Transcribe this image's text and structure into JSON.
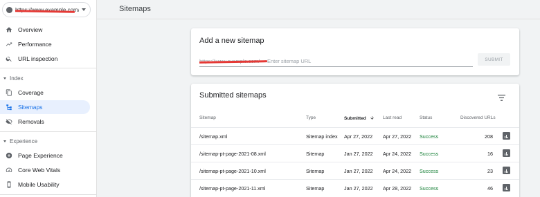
{
  "app": {
    "property_url": "https://www.example.com/",
    "page_title": "Sitemaps"
  },
  "sidebar": {
    "items_top": [
      {
        "label": "Overview",
        "icon": "home-icon"
      },
      {
        "label": "Performance",
        "icon": "trending-up-icon"
      },
      {
        "label": "URL inspection",
        "icon": "search-icon"
      }
    ],
    "sections": [
      {
        "header": "Index",
        "items": [
          {
            "label": "Coverage",
            "icon": "file-copy-icon"
          },
          {
            "label": "Sitemaps",
            "icon": "sitemap-icon",
            "active": true
          },
          {
            "label": "Removals",
            "icon": "visibility-off-icon"
          }
        ]
      },
      {
        "header": "Experience",
        "items": [
          {
            "label": "Page Experience",
            "icon": "add-circle-icon"
          },
          {
            "label": "Core Web Vitals",
            "icon": "speed-gauge-icon"
          },
          {
            "label": "Mobile Usability",
            "icon": "phone-icon"
          }
        ]
      }
    ]
  },
  "add_sitemap": {
    "title": "Add a new sitemap",
    "url_prefix": "https://www.example.com/",
    "placeholder": "Enter sitemap URL",
    "value": "",
    "submit_label": "SUBMIT"
  },
  "submitted": {
    "title": "Submitted sitemaps",
    "columns": [
      "Sitemap",
      "Type",
      "Submitted",
      "Last read",
      "Status",
      "Discovered URLs"
    ],
    "sorted_column": "Submitted",
    "rows": [
      {
        "sitemap": "/sitemap.xml",
        "type": "Sitemap index",
        "submitted": "Apr 27, 2022",
        "last_read": "Apr 27, 2022",
        "status": "Success",
        "discovered": "208"
      },
      {
        "sitemap": "/sitemap-pt-page-2021-08.xml",
        "type": "Sitemap",
        "submitted": "Jan 27, 2022",
        "last_read": "Apr 24, 2022",
        "status": "Success",
        "discovered": "16"
      },
      {
        "sitemap": "/sitemap-pt-page-2021-10.xml",
        "type": "Sitemap",
        "submitted": "Jan 27, 2022",
        "last_read": "Apr 24, 2022",
        "status": "Success",
        "discovered": "23"
      },
      {
        "sitemap": "/sitemap-pt-page-2021-11.xml",
        "type": "Sitemap",
        "submitted": "Jan 27, 2022",
        "last_read": "Apr 28, 2022",
        "status": "Success",
        "discovered": "46"
      }
    ]
  },
  "colors": {
    "accent": "#1a73e8",
    "active_bg": "#e8f0fe",
    "success": "#188038",
    "redaction": "#e53935"
  }
}
